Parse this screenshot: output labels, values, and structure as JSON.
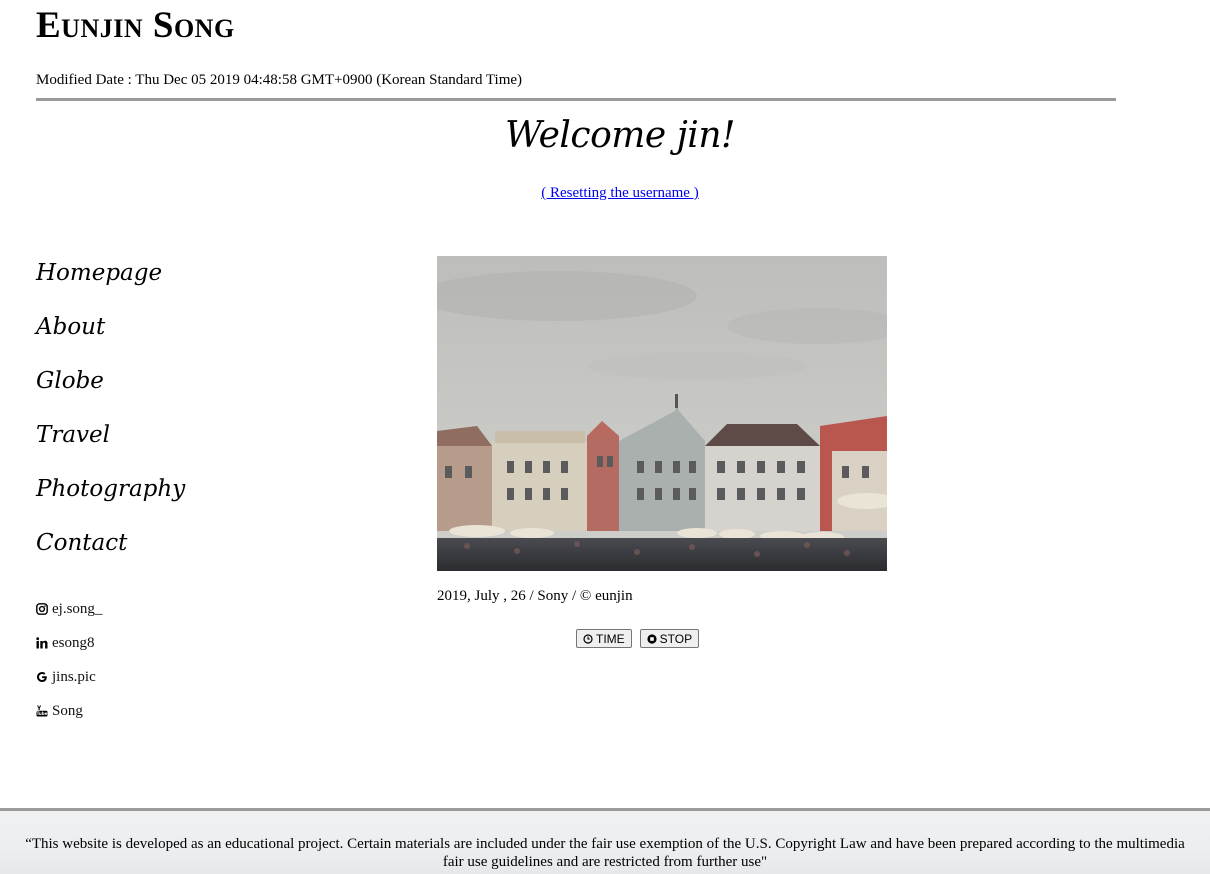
{
  "header": {
    "title": "Eunjin Song",
    "modified_label": "Modified Date : ",
    "modified_value": "Thu Dec 05 2019 04:48:58 GMT+0900 (Korean Standard Time)"
  },
  "welcome": {
    "text": "Welcome jin!",
    "reset_link": "( Resetting the username )"
  },
  "nav": {
    "items": [
      "Homepage",
      "About",
      "Globe",
      "Travel",
      "Photography",
      "Contact"
    ]
  },
  "social": {
    "items": [
      {
        "icon": "instagram-icon",
        "label": "ej.song_"
      },
      {
        "icon": "linkedin-icon",
        "label": "esong8"
      },
      {
        "icon": "google-icon",
        "label": "jins.pic"
      },
      {
        "icon": "youtube-icon",
        "label": "Song"
      }
    ]
  },
  "gallery": {
    "caption": "2019, July , 26 / Sony / © eunjin",
    "time_button": "TIME",
    "stop_button": "STOP"
  },
  "footer": {
    "text": "“This website is developed as an educational project. Certain materials are included under the fair use exemption of the U.S. Copyright Law and have been prepared according to the multimedia fair use guidelines and are restricted from further use\""
  },
  "colors": {
    "link": "#0000ee",
    "rule": "#9a9a9a",
    "footer_bg": "#eceef0"
  }
}
